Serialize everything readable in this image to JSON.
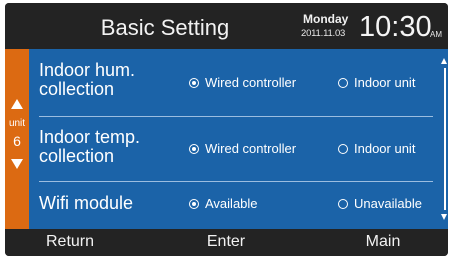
{
  "header": {
    "title": "Basic Setting",
    "day": "Monday",
    "date": "2011.11.03",
    "time": "10:30",
    "ampm": "AM"
  },
  "unit": {
    "label": "unit",
    "number": "6"
  },
  "rows": [
    {
      "label_line1": "Indoor hum.",
      "label_line2": "collection",
      "option1": "Wired controller",
      "option2": "Indoor unit",
      "selected": 1
    },
    {
      "label_line1": "Indoor temp.",
      "label_line2": "collection",
      "option1": "Wired controller",
      "option2": "Indoor unit",
      "selected": 1
    },
    {
      "label_line1": "Wifi module",
      "option1": "Available",
      "option2": "Unavailable",
      "selected": 1
    }
  ],
  "footer": {
    "return_label": "Return",
    "enter_label": "Enter",
    "main_label": "Main"
  },
  "colors": {
    "panel": "#1b63a8",
    "unit_strip": "#dc6a12",
    "bar": "#232323"
  }
}
